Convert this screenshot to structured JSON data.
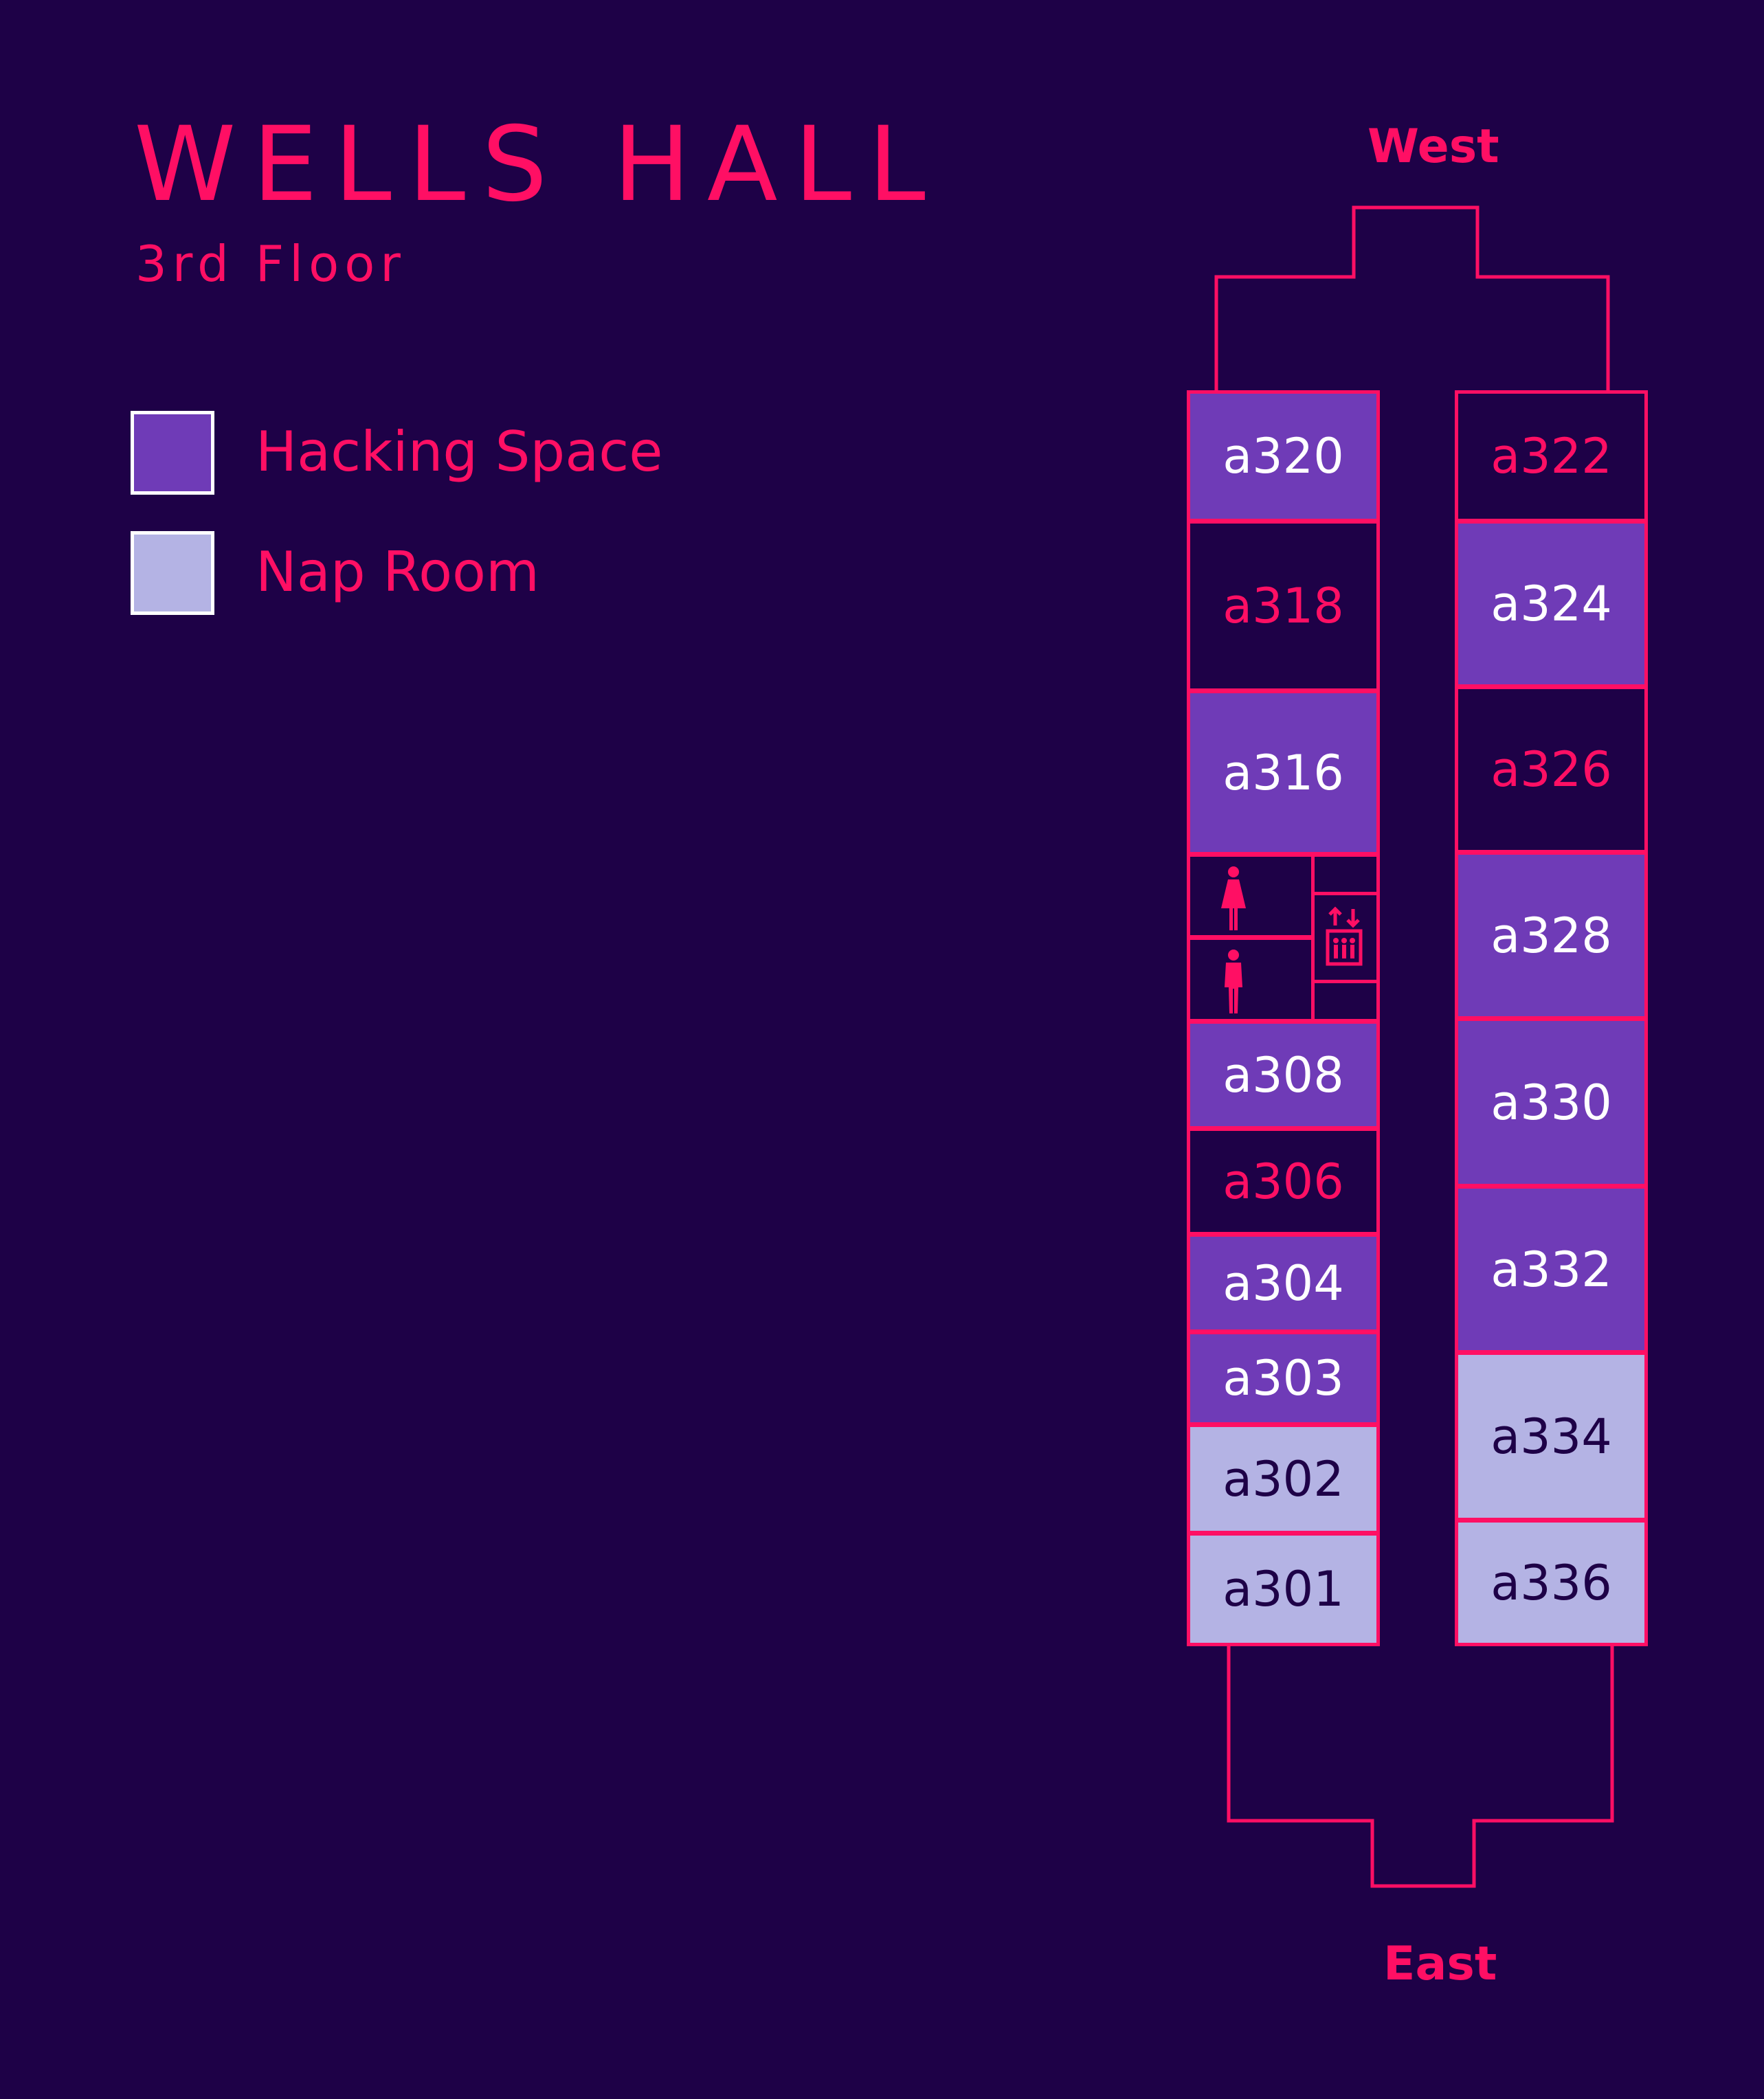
{
  "header": {
    "title": "WELLS HALL",
    "subtitle": "3rd Floor"
  },
  "legend": [
    {
      "label": "Hacking Space",
      "color": "#6f3bb7"
    },
    {
      "label": "Nap Room",
      "color": "#b4b3e4"
    }
  ],
  "directions": {
    "top": "West",
    "bottom": "East"
  },
  "colors": {
    "background": "#1e0147",
    "accent": "#ff0f64",
    "hacking": "#6f3bb7",
    "nap": "#b4b3e4"
  },
  "rooms": {
    "left": [
      {
        "id": "a320",
        "type": "hacking"
      },
      {
        "id": "a318",
        "type": "none"
      },
      {
        "id": "a316",
        "type": "hacking"
      },
      {
        "id": "a308",
        "type": "hacking"
      },
      {
        "id": "a306",
        "type": "none"
      },
      {
        "id": "a304",
        "type": "hacking"
      },
      {
        "id": "a303",
        "type": "hacking"
      },
      {
        "id": "a302",
        "type": "nap"
      },
      {
        "id": "a301",
        "type": "nap"
      }
    ],
    "right": [
      {
        "id": "a322",
        "type": "none"
      },
      {
        "id": "a324",
        "type": "hacking"
      },
      {
        "id": "a326",
        "type": "none"
      },
      {
        "id": "a328",
        "type": "hacking"
      },
      {
        "id": "a330",
        "type": "hacking"
      },
      {
        "id": "a332",
        "type": "hacking"
      },
      {
        "id": "a334",
        "type": "nap"
      },
      {
        "id": "a336",
        "type": "nap"
      }
    ]
  },
  "facilities": [
    {
      "name": "womens-restroom-icon"
    },
    {
      "name": "mens-restroom-icon"
    },
    {
      "name": "elevator-icon"
    }
  ]
}
